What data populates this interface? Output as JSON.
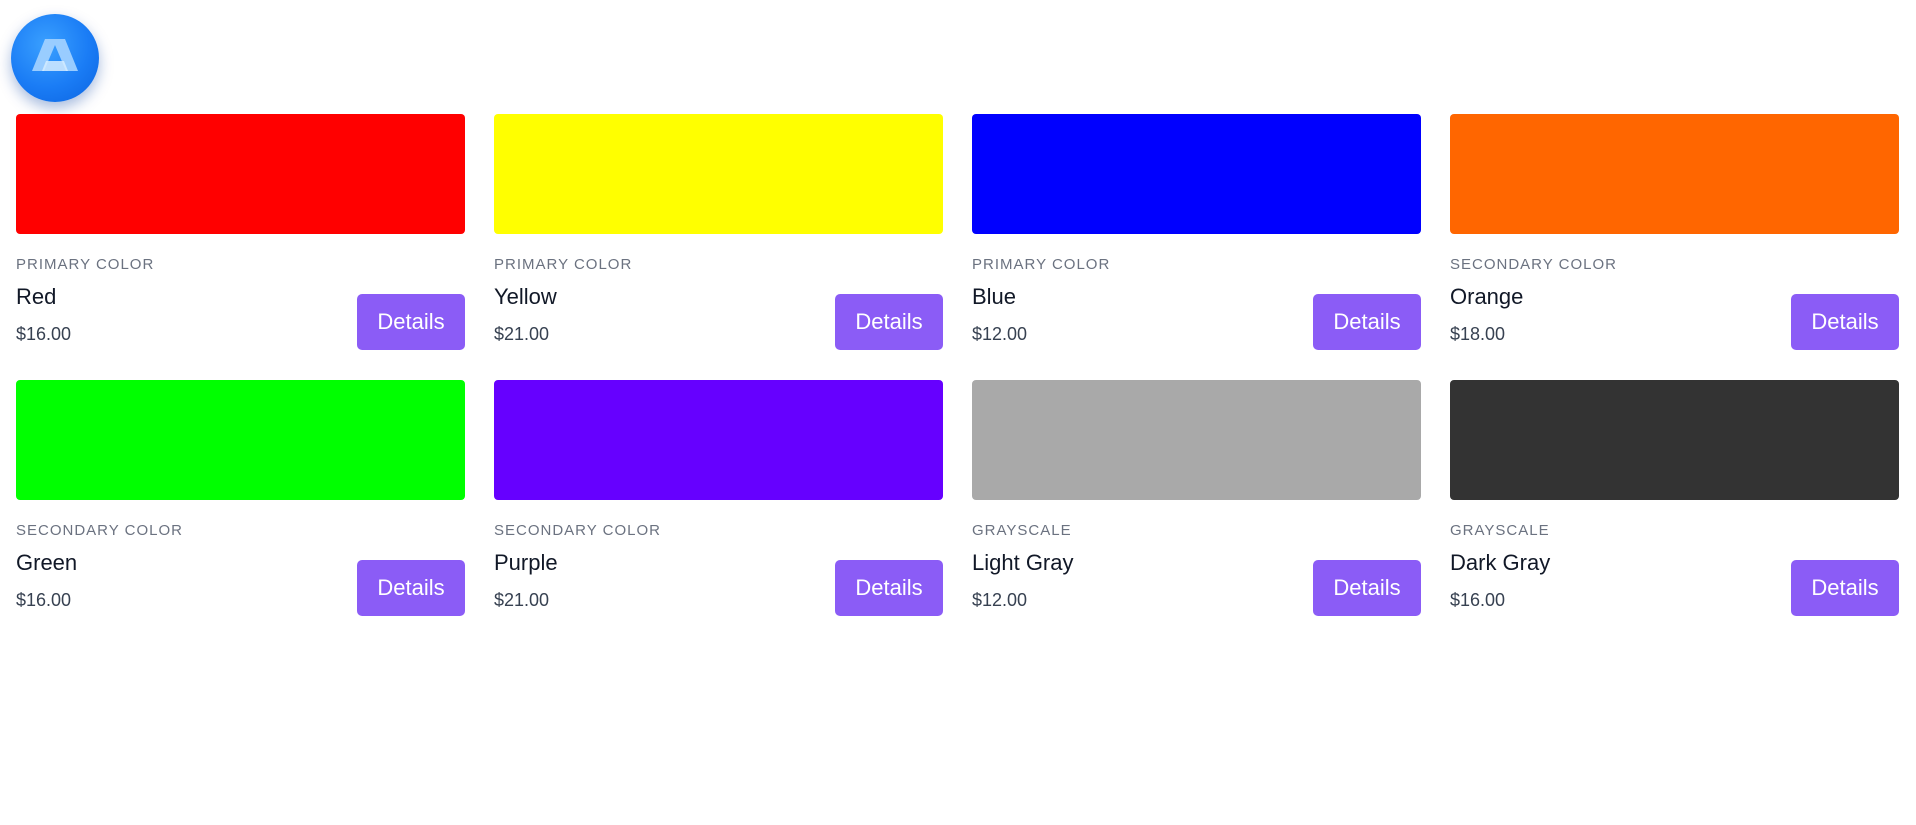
{
  "app": {
    "logo_icon": "app-logo-icon",
    "logo_color": "#1a7cf5"
  },
  "products": [
    {
      "category": "PRIMARY COLOR",
      "name": "Red",
      "price": "$16.00",
      "swatch_color": "#ff0000",
      "button_label": "Details"
    },
    {
      "category": "PRIMARY COLOR",
      "name": "Yellow",
      "price": "$21.00",
      "swatch_color": "#ffff00",
      "button_label": "Details"
    },
    {
      "category": "PRIMARY COLOR",
      "name": "Blue",
      "price": "$12.00",
      "swatch_color": "#0000ff",
      "button_label": "Details"
    },
    {
      "category": "SECONDARY COLOR",
      "name": "Orange",
      "price": "$18.00",
      "swatch_color": "#ff6600",
      "button_label": "Details"
    },
    {
      "category": "SECONDARY COLOR",
      "name": "Green",
      "price": "$16.00",
      "swatch_color": "#00ff00",
      "button_label": "Details"
    },
    {
      "category": "SECONDARY COLOR",
      "name": "Purple",
      "price": "$21.00",
      "swatch_color": "#6600ff",
      "button_label": "Details"
    },
    {
      "category": "GRAYSCALE",
      "name": "Light Gray",
      "price": "$12.00",
      "swatch_color": "#a9a9a9",
      "button_label": "Details"
    },
    {
      "category": "GRAYSCALE",
      "name": "Dark Gray",
      "price": "$16.00",
      "swatch_color": "#333333",
      "button_label": "Details"
    }
  ],
  "colors": {
    "button_bg": "#8b5cf6",
    "category_text": "#6b7280"
  }
}
